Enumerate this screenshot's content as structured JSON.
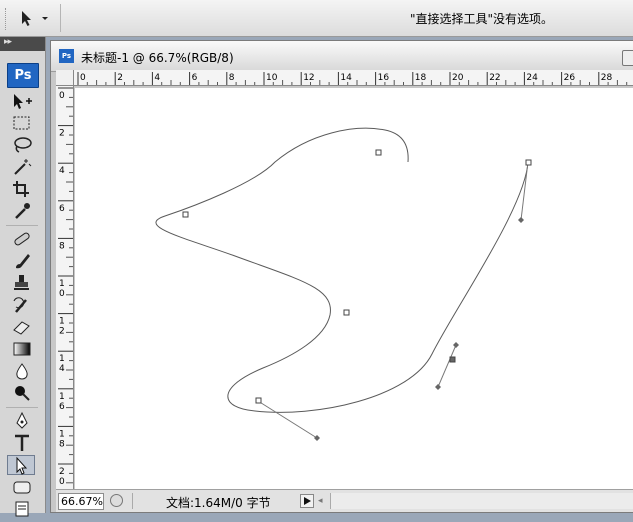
{
  "options_bar": {
    "message": "\"直接选择工具\"没有选项。",
    "tool_icon": "direct-selection-arrow",
    "dropdown_icon": "caret-down"
  },
  "tools_panel": {
    "collapse_glyph": "▸▸",
    "logo": "Ps",
    "tools": [
      "path-selection-icon",
      "marquee-icon",
      "lasso-icon",
      "magic-wand-icon",
      "crop-icon",
      "eyedropper-icon",
      "healing-brush-icon",
      "brush-icon",
      "clone-stamp-icon",
      "history-brush-icon",
      "eraser-icon",
      "gradient-icon",
      "blur-icon",
      "dodge-icon",
      "pen-icon",
      "type-icon",
      "direct-selection-icon",
      "shape-icon",
      "notes-icon"
    ],
    "active_tool": "direct-selection-icon"
  },
  "document": {
    "title": "未标题-1 @ 66.7%(RGB/8)",
    "icon_label": "Ps",
    "hruler_labels": [
      "0",
      "2",
      "4",
      "6",
      "8",
      "10",
      "12",
      "14",
      "16",
      "18",
      "20",
      "22",
      "24",
      "26",
      "28"
    ],
    "vruler_labels": [
      "0",
      "2",
      "4",
      "6",
      "8",
      "1\n0",
      "1\n2",
      "1\n4",
      "1\n6",
      "1\n8",
      "2\n0"
    ]
  },
  "status": {
    "zoom": "66.67%",
    "doc_size": "文档:1.64M/0 字节"
  }
}
